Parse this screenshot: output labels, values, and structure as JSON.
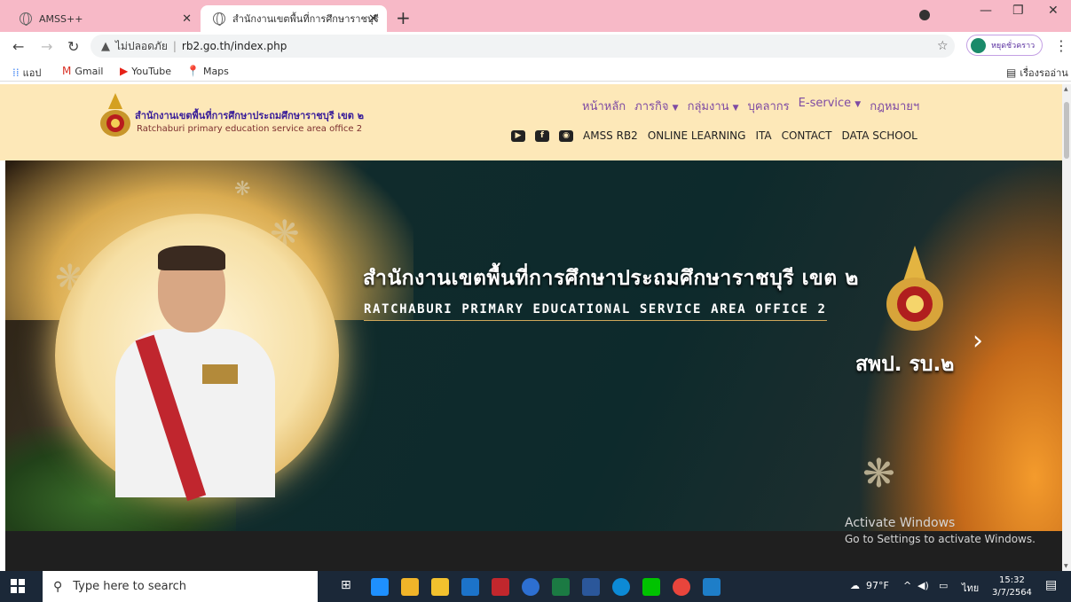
{
  "browser": {
    "tabs": [
      {
        "title": "AMSS++",
        "active": false
      },
      {
        "title": "สำนักงานเขตพื้นที่การศึกษาราชบุรี เข",
        "active": true
      }
    ],
    "new_tab": "+",
    "security_text": "ไม่ปลอดภัย",
    "url": "rb2.go.th/index.php",
    "profile_button": "หยุดชั่วคราว",
    "bookmarks": [
      {
        "label": "แอป",
        "icon": "apps-icon"
      },
      {
        "label": "Gmail",
        "icon": "gmail-icon"
      },
      {
        "label": "YouTube",
        "icon": "youtube-icon"
      },
      {
        "label": "Maps",
        "icon": "maps-icon"
      }
    ],
    "reading_list": "เรื่องรออ่าน"
  },
  "site": {
    "org_name_th": "สำนักงานเขตพื้นที่การศึกษาประถมศึกษาราชบุรี เขต ๒",
    "org_name_en": "Ratchaburi primary education service area office 2",
    "nav": [
      {
        "label": "หน้าหลัก",
        "dropdown": false
      },
      {
        "label": "ภารกิจ",
        "dropdown": true
      },
      {
        "label": "กลุ่มงาน",
        "dropdown": true
      },
      {
        "label": "บุคลากร",
        "dropdown": false
      },
      {
        "label": "E-service",
        "dropdown": true
      },
      {
        "label": "กฎหมายฯ",
        "dropdown": false
      }
    ],
    "subnav": [
      "AMSS RB2",
      "ONLINE LEARNING",
      "ITA",
      "CONTACT",
      "DATA SCHOOL"
    ],
    "social_icons": [
      "youtube-icon",
      "facebook-icon",
      "line-icon"
    ],
    "banner": {
      "title_th": "สำนักงานเขตพื้นที่การศึกษาประถมศึกษาราชบุรี เขต ๒",
      "title_en": "RATCHABURI PRIMARY EDUCATIONAL SERVICE AREA OFFICE 2",
      "abbr": "สพป. รบ.๒"
    }
  },
  "watermark": {
    "line1": "Activate Windows",
    "line2": "Go to Settings to activate Windows."
  },
  "taskbar": {
    "search_placeholder": "Type here to search",
    "weather": "97°F",
    "lang": "ไทย",
    "time": "15:32",
    "date": "3/7/2564"
  },
  "colors": {
    "tabstrip": "#f7b9c7",
    "header_bg": "#fde8b8",
    "nav_text": "#7e4ba3",
    "taskbar": "#1b2838"
  }
}
